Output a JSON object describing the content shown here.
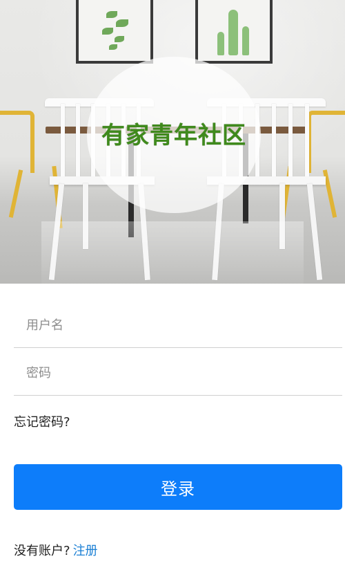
{
  "hero": {
    "logo_text": "有家青年社区"
  },
  "form": {
    "username_placeholder": "用户名",
    "username_value": "",
    "password_placeholder": "密码",
    "password_value": "",
    "forgot_label": "忘记密码?",
    "login_label": "登录"
  },
  "signup": {
    "prompt": "没有账户?",
    "link_label": "注册"
  },
  "colors": {
    "primary_button": "#0d7dfa",
    "link": "#1a7fd4",
    "logo_green": "#3f8a1c"
  }
}
